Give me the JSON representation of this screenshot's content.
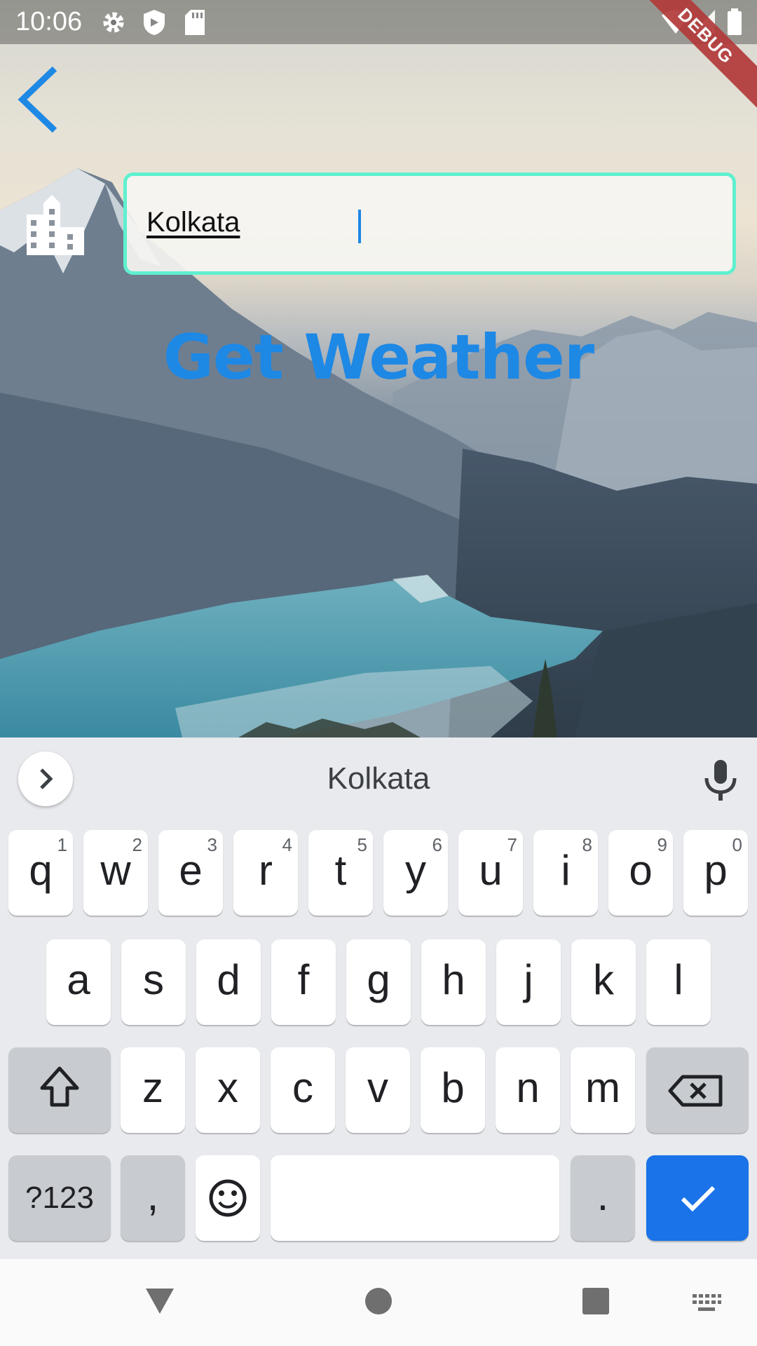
{
  "status_bar": {
    "time": "10:06",
    "icons": [
      "settings-icon",
      "shield-icon",
      "sd-card-icon",
      "wifi-icon",
      "signal-icon",
      "battery-icon"
    ],
    "debug_banner": "DEBUG"
  },
  "screen": {
    "back_icon": "chevron-left-icon",
    "city_icon": "location-city-icon",
    "city_input_value": "Kolkata",
    "get_weather_label": "Get Weather",
    "colors": {
      "accent": "#1e88e5",
      "field_border": "#5ff0cf"
    }
  },
  "keyboard": {
    "suggestion": "Kolkata",
    "row1": [
      {
        "key": "q",
        "hint": "1"
      },
      {
        "key": "w",
        "hint": "2"
      },
      {
        "key": "e",
        "hint": "3"
      },
      {
        "key": "r",
        "hint": "4"
      },
      {
        "key": "t",
        "hint": "5"
      },
      {
        "key": "y",
        "hint": "6"
      },
      {
        "key": "u",
        "hint": "7"
      },
      {
        "key": "i",
        "hint": "8"
      },
      {
        "key": "o",
        "hint": "9"
      },
      {
        "key": "p",
        "hint": "0"
      }
    ],
    "row2": [
      "a",
      "s",
      "d",
      "f",
      "g",
      "h",
      "j",
      "k",
      "l"
    ],
    "row3": [
      "z",
      "x",
      "c",
      "v",
      "b",
      "n",
      "m"
    ],
    "symbols_label": "?123",
    "comma": ",",
    "period": ".",
    "icons": [
      "chevron-right-icon",
      "microphone-icon",
      "shift-icon",
      "backspace-icon",
      "emoji-icon",
      "check-icon"
    ]
  },
  "nav_bar": {
    "icons": [
      "back-triangle-icon",
      "home-circle-icon",
      "recents-square-icon",
      "keyboard-switch-icon"
    ]
  }
}
